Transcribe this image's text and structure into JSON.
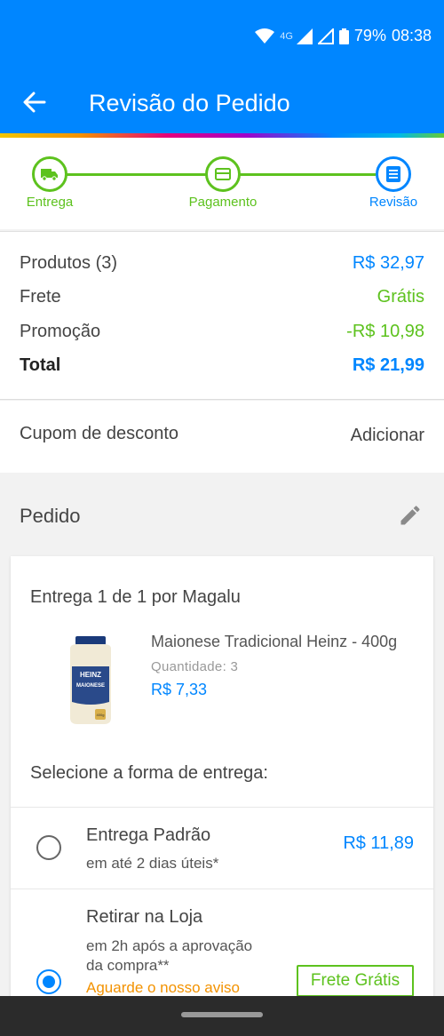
{
  "status_bar": {
    "network": "4G",
    "battery": "79%",
    "time": "08:38"
  },
  "header": {
    "title": "Revisão do Pedido"
  },
  "stepper": {
    "steps": [
      {
        "label": "Entrega",
        "icon": "truck-icon",
        "state": "done"
      },
      {
        "label": "Pagamento",
        "icon": "card-icon",
        "state": "done"
      },
      {
        "label": "Revisão",
        "icon": "document-icon",
        "state": "active"
      }
    ]
  },
  "summary": {
    "products_label": "Produtos (3)",
    "products_value": "R$ 32,97",
    "shipping_label": "Frete",
    "shipping_value": "Grátis",
    "promo_label": "Promoção",
    "promo_value": "-R$ 10,98",
    "total_label": "Total",
    "total_value": "R$ 21,99"
  },
  "coupon": {
    "label": "Cupom de desconto",
    "action": "Adicionar"
  },
  "order": {
    "title": "Pedido",
    "seller": "Entrega 1 de 1 por Magalu",
    "product": {
      "name": "Maionese Tradicional Heinz - 400g",
      "quantity": "Quantidade:  3",
      "price": "R$ 7,33",
      "image_brand": "HEINZ",
      "image_label": "MAIONESE",
      "image_weight": "400g"
    },
    "select_label": "Selecione a forma de entrega:",
    "options": [
      {
        "title": "Entrega Padrão",
        "subtitle": "em até 2 dias úteis*",
        "price": "R$ 11,89",
        "selected": false
      },
      {
        "title": "Retirar na Loja",
        "subtitle_line1": "em 2h após a aprovação",
        "subtitle_line2": "da compra**",
        "warning": "Aguarde o nosso aviso",
        "badge": "Frete Grátis",
        "selected": true
      }
    ]
  },
  "colors": {
    "primary": "#0086ff",
    "success": "#5dc21e",
    "warning": "#f39200"
  }
}
